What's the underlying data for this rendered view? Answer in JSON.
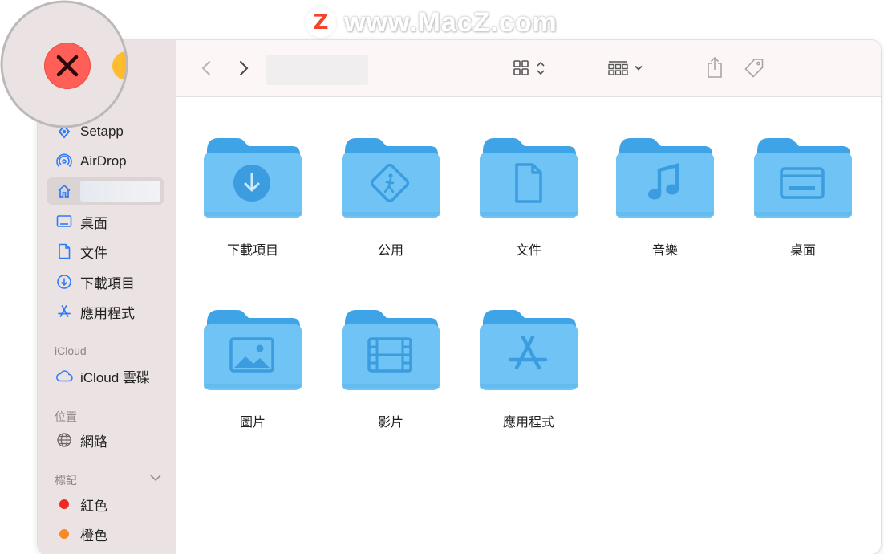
{
  "watermark": {
    "text": "www.MacZ.com",
    "logo_letter": "Z"
  },
  "sidebar": {
    "items": [
      {
        "label": "Setapp",
        "icon": "setapp-icon"
      },
      {
        "label": "AirDrop",
        "icon": "airdrop-icon"
      },
      {
        "label": "",
        "icon": "home-icon",
        "selected": true
      },
      {
        "label": "桌面",
        "icon": "desktop-icon"
      },
      {
        "label": "文件",
        "icon": "document-icon"
      },
      {
        "label": "下載項目",
        "icon": "downloads-icon"
      },
      {
        "label": "應用程式",
        "icon": "applications-icon"
      }
    ],
    "icloud": {
      "header": "iCloud",
      "items": [
        {
          "label": "iCloud 雲碟",
          "icon": "cloud-icon"
        }
      ]
    },
    "locations": {
      "header": "位置",
      "items": [
        {
          "label": "網路",
          "icon": "network-icon"
        }
      ]
    },
    "tags": {
      "header": "標記",
      "items": [
        {
          "label": "紅色",
          "color": "#ee2a24"
        },
        {
          "label": "橙色",
          "color": "#f58a26"
        }
      ]
    }
  },
  "toolbar": {
    "icons": [
      "chevron-left-icon",
      "chevron-right-icon",
      "icon-view-icon",
      "group-icon",
      "share-icon",
      "tag-icon",
      "more-actions-icon",
      "search-icon"
    ]
  },
  "folders": [
    {
      "label": "下載項目",
      "glyph": "downloads"
    },
    {
      "label": "公用",
      "glyph": "public"
    },
    {
      "label": "文件",
      "glyph": "document"
    },
    {
      "label": "音樂",
      "glyph": "music"
    },
    {
      "label": "桌面",
      "glyph": "desktop"
    },
    {
      "label": "圖片",
      "glyph": "pictures"
    },
    {
      "label": "影片",
      "glyph": "movies"
    },
    {
      "label": "應用程式",
      "glyph": "applications"
    }
  ],
  "colors": {
    "accent": "#2f7bf6",
    "folder_body": "#6fc4f5",
    "folder_tab": "#3fa3e8",
    "folder_glyph": "#3c9ce0",
    "close_button": "#ff5f57",
    "sidebar_bg": "#ebe2e3"
  }
}
